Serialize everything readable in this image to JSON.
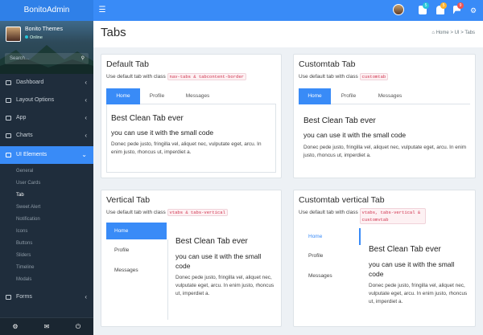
{
  "app": {
    "logo": "BonitoAdmin",
    "menu_icon": "hamburger-icon"
  },
  "topbar": {
    "badges": [
      {
        "name": "messages-icon",
        "count": "5",
        "color": "#26c6da"
      },
      {
        "name": "notifications-icon",
        "count": "5",
        "color": "#ffb22b"
      },
      {
        "name": "flag-icon",
        "count": "9",
        "color": "#ef5350"
      }
    ],
    "settings_icon": "gear-icon"
  },
  "sidebar": {
    "user": {
      "name": "Bonito Themes",
      "status": "Online"
    },
    "search_placeholder": "Search...",
    "items": [
      {
        "label": "Dashboard",
        "icon": "dashboard-icon"
      },
      {
        "label": "Layout Options",
        "icon": "layout-icon"
      },
      {
        "label": "App",
        "icon": "app-icon"
      },
      {
        "label": "Charts",
        "icon": "charts-icon"
      },
      {
        "label": "UI Elements",
        "icon": "ui-icon"
      },
      {
        "label": "Forms",
        "icon": "forms-icon"
      }
    ],
    "subitems": [
      "General",
      "User Cards",
      "Tab",
      "Sweet Alert",
      "Notification",
      "Icons",
      "Buttons",
      "Sliders",
      "Timeline",
      "Modals"
    ],
    "footer_icons": [
      "gear-icon",
      "mail-icon",
      "power-icon"
    ]
  },
  "page": {
    "title": "Tabs",
    "breadcrumb": [
      "Home",
      "UI",
      "Tabs"
    ]
  },
  "content": {
    "heading": "Best Clean Tab ever",
    "subheading": "you can use it with the small code",
    "text": "Donec pede justo, fringilla vel, aliquet nec, vulputate eget, arcu. In enim justo, rhoncus ut, imperdiet a."
  },
  "cards": [
    {
      "title": "Default Tab",
      "sub": "Use default tab with class",
      "code": "nav-tabs & tabcontent-border",
      "tabs": [
        "Home",
        "Profile",
        "Messages"
      ]
    },
    {
      "title": "Customtab Tab",
      "sub": "Use default tab with class",
      "code": "customtab",
      "tabs": [
        "Home",
        "Profile",
        "Messages"
      ]
    },
    {
      "title": "Vertical Tab",
      "sub": "Use default tab with class",
      "code": "vtabs & tabs-vertical",
      "tabs": [
        "Home",
        "Profile",
        "Messages"
      ]
    },
    {
      "title": "Customtab vertical Tab",
      "sub": "Use default tab with class",
      "code": "vtabs, tabs-vertical & customvtab",
      "tabs": [
        "Home",
        "Profile",
        "Messages"
      ]
    }
  ],
  "colors": {
    "primary": "#398bf7",
    "sidebar": "#1f2d3c"
  }
}
